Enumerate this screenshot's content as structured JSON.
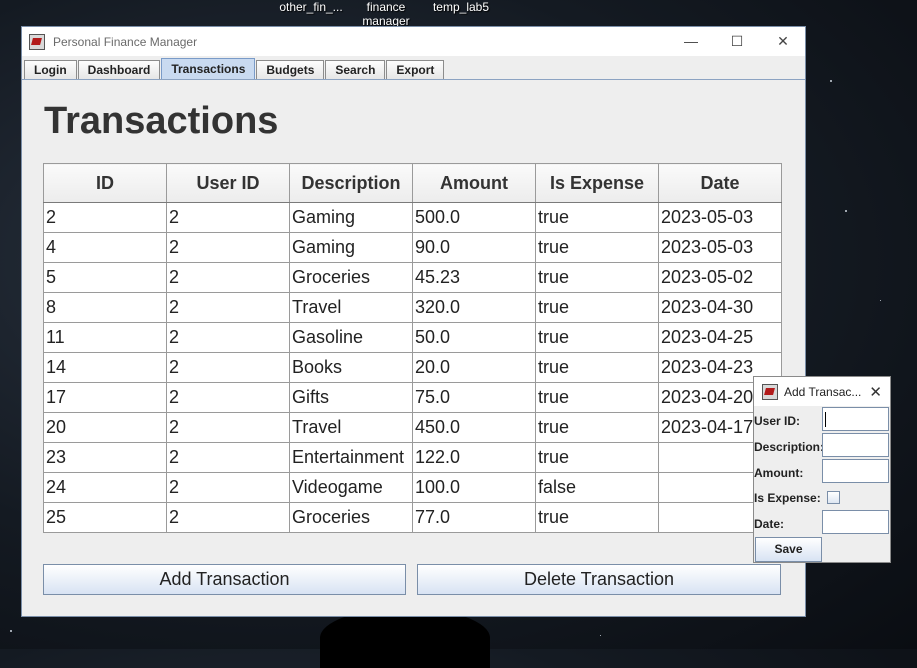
{
  "desktop": {
    "icons": [
      "other_fin_...",
      "finance manager",
      "temp_lab5"
    ]
  },
  "window": {
    "title": "Personal Finance Manager",
    "controls": {
      "minimize": "—",
      "maximize": "☐",
      "close": "✕"
    }
  },
  "tabs": [
    {
      "label": "Login",
      "active": false
    },
    {
      "label": "Dashboard",
      "active": false
    },
    {
      "label": "Transactions",
      "active": true
    },
    {
      "label": "Budgets",
      "active": false
    },
    {
      "label": "Search",
      "active": false
    },
    {
      "label": "Export",
      "active": false
    }
  ],
  "page": {
    "title": "Transactions"
  },
  "table": {
    "columns": [
      "ID",
      "User ID",
      "Description",
      "Amount",
      "Is Expense",
      "Date"
    ],
    "rows": [
      [
        "2",
        "2",
        "Gaming",
        "500.0",
        "true",
        "2023-05-03"
      ],
      [
        "4",
        "2",
        "Gaming",
        "90.0",
        "true",
        "2023-05-03"
      ],
      [
        "5",
        "2",
        "Groceries",
        "45.23",
        "true",
        "2023-05-02"
      ],
      [
        "8",
        "2",
        "Travel",
        "320.0",
        "true",
        "2023-04-30"
      ],
      [
        "11",
        "2",
        "Gasoline",
        "50.0",
        "true",
        "2023-04-25"
      ],
      [
        "14",
        "2",
        "Books",
        "20.0",
        "true",
        "2023-04-23"
      ],
      [
        "17",
        "2",
        "Gifts",
        "75.0",
        "true",
        "2023-04-20"
      ],
      [
        "20",
        "2",
        "Travel",
        "450.0",
        "true",
        "2023-04-17"
      ],
      [
        "23",
        "2",
        "Entertainment",
        "122.0",
        "true",
        ""
      ],
      [
        "24",
        "2",
        "Videogame",
        "100.0",
        "false",
        ""
      ],
      [
        "25",
        "2",
        "Groceries",
        "77.0",
        "true",
        ""
      ]
    ]
  },
  "buttons": {
    "add": "Add Transaction",
    "delete": "Delete Transaction"
  },
  "dialog": {
    "title": "Add Transac...",
    "close": "✕",
    "labels": {
      "user_id": "User ID:",
      "description": "Description:",
      "amount": "Amount:",
      "is_expense": "Is Expense:",
      "date": "Date:"
    },
    "values": {
      "user_id": "",
      "description": "",
      "amount": "",
      "date": ""
    },
    "is_expense_checked": false,
    "save": "Save"
  }
}
